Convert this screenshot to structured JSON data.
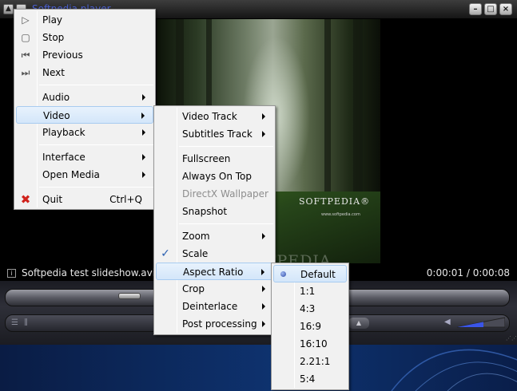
{
  "window": {
    "title": "Softpedia player",
    "btn_min": "–",
    "btn_max": "□",
    "btn_close": "×"
  },
  "status": {
    "filename": "Softpedia test slideshow.avi",
    "time": "0:00:01 / 0:00:08"
  },
  "video": {
    "watermark": "SOFTPEDIA®",
    "watermark_sub": "www.softpedia.com",
    "overlay_watermark": "SOFTPEDIA"
  },
  "volume_level": 0.55,
  "main_menu": {
    "items": [
      {
        "label": "Play",
        "icon": "play-icon"
      },
      {
        "label": "Stop",
        "icon": "stop-icon"
      },
      {
        "label": "Previous",
        "icon": "previous-icon"
      },
      {
        "label": "Next",
        "icon": "next-icon"
      },
      {
        "label": "Audio"
      },
      {
        "label": "Video"
      },
      {
        "label": "Playback"
      },
      {
        "label": "Interface"
      },
      {
        "label": "Open Media"
      },
      {
        "label": "Quit",
        "shortcut": "Ctrl+Q",
        "icon": "quit-icon"
      }
    ]
  },
  "video_menu": {
    "items": [
      {
        "label": "Video Track"
      },
      {
        "label": "Subtitles Track"
      },
      {
        "label": "Fullscreen"
      },
      {
        "label": "Always On Top"
      },
      {
        "label": "DirectX Wallpaper",
        "disabled": true
      },
      {
        "label": "Snapshot"
      },
      {
        "label": "Zoom"
      },
      {
        "label": "Scale",
        "checked": true
      },
      {
        "label": "Aspect Ratio"
      },
      {
        "label": "Crop"
      },
      {
        "label": "Deinterlace"
      },
      {
        "label": "Post processing"
      }
    ]
  },
  "aspect_menu": {
    "selected": "Default",
    "items": [
      {
        "label": "Default"
      },
      {
        "label": "1:1"
      },
      {
        "label": "4:3"
      },
      {
        "label": "16:9"
      },
      {
        "label": "16:10"
      },
      {
        "label": "2.21:1"
      },
      {
        "label": "5:4"
      }
    ]
  },
  "colors": {
    "menu_bg": "#f1f1f1",
    "highlight": "#d4e6fa",
    "title_text": "#4a5fd0"
  }
}
